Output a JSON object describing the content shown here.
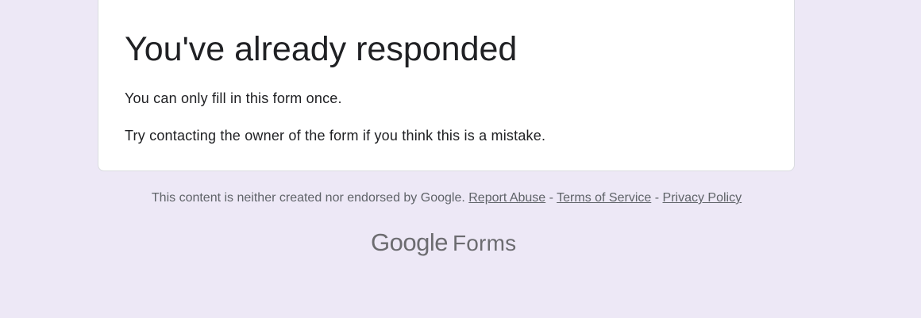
{
  "card": {
    "title": "You've already responded",
    "line1": "You can only fill in this form once.",
    "line2": "Try contacting the owner of the form if you think this is a mistake."
  },
  "footer": {
    "disclaimer": "This content is neither created nor endorsed by Google.",
    "report_abuse": "Report Abuse",
    "separator": "-",
    "terms": "Terms of Service",
    "privacy": "Privacy Policy"
  },
  "brand": {
    "logo_text": "Google",
    "product": "Forms"
  },
  "colors": {
    "background": "#ede8f6",
    "card": "#ffffff",
    "text": "#202124",
    "muted": "#5f6368"
  }
}
